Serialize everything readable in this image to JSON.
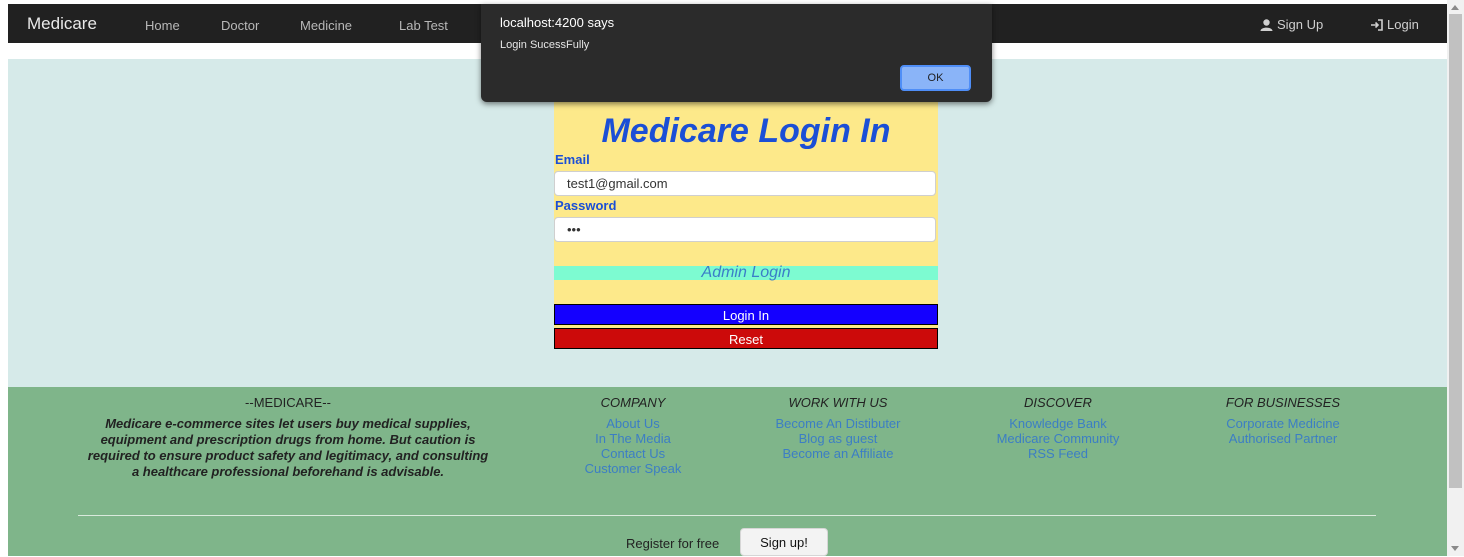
{
  "navbar": {
    "brand": "Medicare",
    "links": [
      "Home",
      "Doctor",
      "Medicine",
      "Lab Test"
    ],
    "signup": "Sign Up",
    "login": "Login"
  },
  "login": {
    "title": "Medicare Login In",
    "email_label": "Email",
    "email_value": "test1@gmail.com",
    "password_label": "Password",
    "password_value": "•••",
    "admin_link": "Admin Login",
    "login_button": "Login In",
    "reset_button": "Reset"
  },
  "dialog": {
    "title": "localhost:4200 says",
    "message": "Login SucessFully",
    "ok": "OK"
  },
  "footer": {
    "about_heading": "--MEDICARE--",
    "about_text": "Medicare e-commerce sites let users buy medical supplies, equipment and prescription drugs from home. But caution is required to ensure product safety and legitimacy, and consulting a healthcare professional beforehand is advisable.",
    "company": {
      "heading": "COMPANY",
      "links": [
        "About Us",
        "In The Media",
        "Contact Us",
        "Customer Speak"
      ]
    },
    "work": {
      "heading": "WORK WITH US",
      "links": [
        "Become An Distibuter",
        "Blog as guest",
        "Become an Affiliate"
      ]
    },
    "discover": {
      "heading": "DISCOVER",
      "links": [
        "Knowledge Bank",
        "Medicare Community",
        "RSS Feed"
      ]
    },
    "business": {
      "heading": "FOR BUSINESSES",
      "links": [
        "Corporate Medicine",
        "Authorised Partner"
      ]
    },
    "register_text": "Register for free",
    "signup_button": "Sign up!"
  }
}
